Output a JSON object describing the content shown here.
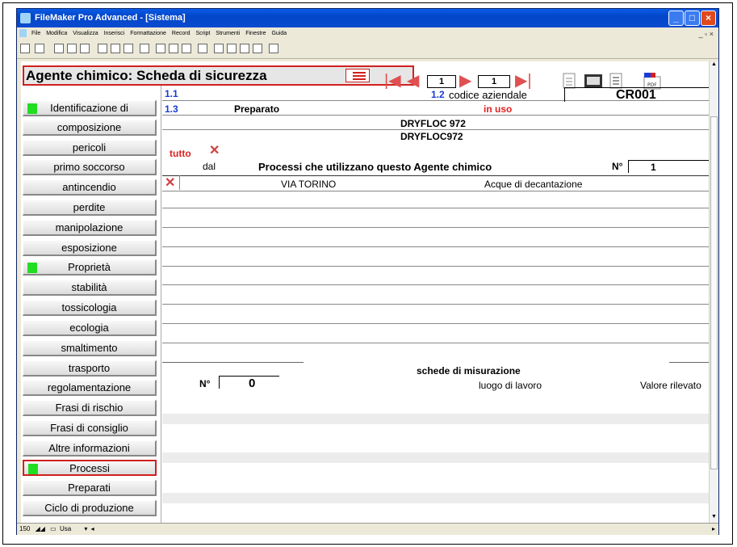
{
  "window": {
    "title": "FileMaker Pro Advanced - [Sistema]"
  },
  "menu": {
    "items": [
      "File",
      "Modifica",
      "Visualizza",
      "Inserisci",
      "Formattazione",
      "Record",
      "Script",
      "Strumenti",
      "Finestre",
      "Guida"
    ]
  },
  "layout": {
    "title": "Agente chimico: Scheda di sicurezza"
  },
  "nav": {
    "record": "1",
    "total": "1"
  },
  "sidebar": {
    "items": [
      {
        "label": "Identificazione di",
        "marked": true
      },
      {
        "label": "composizione"
      },
      {
        "label": "pericoli"
      },
      {
        "label": "primo soccorso"
      },
      {
        "label": "antincendio"
      },
      {
        "label": "perdite"
      },
      {
        "label": "manipolazione"
      },
      {
        "label": "esposizione"
      },
      {
        "label": "Proprietà",
        "marked": true
      },
      {
        "label": "stabilità"
      },
      {
        "label": "tossicologia"
      },
      {
        "label": "ecologia"
      },
      {
        "label": "smaltimento"
      },
      {
        "label": "trasporto"
      },
      {
        "label": "regolamentazione"
      },
      {
        "label": "Frasi di rischio"
      },
      {
        "label": "Frasi di consiglio"
      },
      {
        "label": "Altre informazioni"
      },
      {
        "label": "Processi",
        "marked": true,
        "active": true
      },
      {
        "label": "Preparati"
      },
      {
        "label": "Ciclo di produzione"
      }
    ]
  },
  "form": {
    "num_1_1": "1.1",
    "num_1_2": "1.2",
    "num_1_3": "1.3",
    "codice_label": "codice aziendale",
    "codice_value": "CR001",
    "preparato_label": "Preparato",
    "status": "in uso",
    "name1": "DRYFLOC 972",
    "name2": "DRYFLOC972",
    "tutto": "tutto",
    "dal": "dal",
    "processi_title": "Processi che utilizzano questo Agente chimico",
    "n_label": "N°",
    "n_value": "1",
    "row1_col1": "VIA TORINO",
    "row1_col2": "Acque di decantazione",
    "schede_title": "schede di misurazione",
    "schede_n_label": "N°",
    "schede_n_value": "0",
    "luogo_label": "luogo di lavoro",
    "valore_label": "Valore rilevato"
  },
  "status": {
    "zoom": "150",
    "mode": "Usa"
  },
  "colors": {
    "accent_red": "#d02020",
    "marker_green": "#22dd22",
    "number_blue": "#1a3bd6"
  }
}
